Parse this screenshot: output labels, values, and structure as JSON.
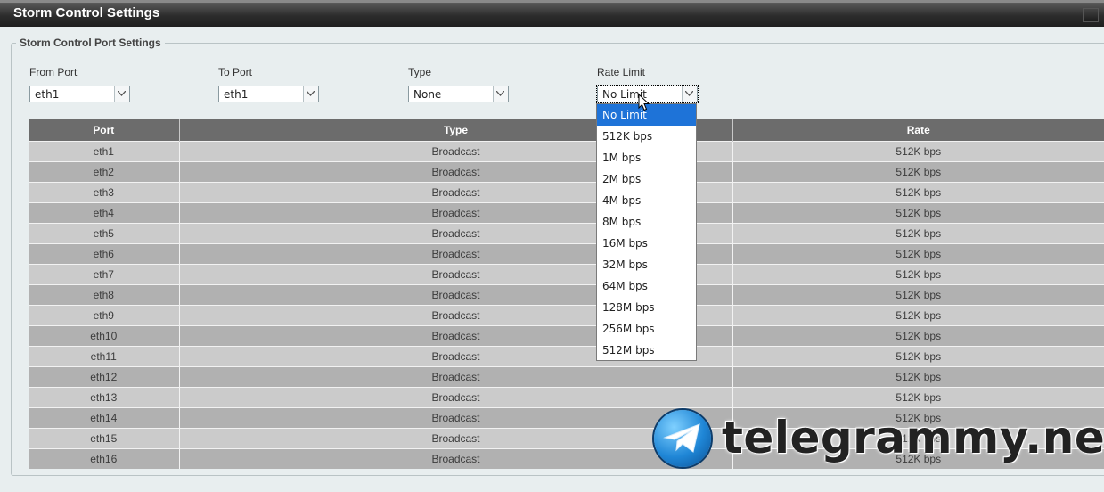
{
  "header": {
    "title": "Storm Control Settings"
  },
  "port_settings": {
    "legend": "Storm Control Port Settings",
    "from_port": {
      "label": "From Port",
      "value": "eth1"
    },
    "to_port": {
      "label": "To Port",
      "value": "eth1"
    },
    "type": {
      "label": "Type",
      "value": "None"
    },
    "rate_limit": {
      "label": "Rate Limit",
      "value": "No Limit",
      "options": [
        "No Limit",
        "512K bps",
        "1M bps",
        "2M bps",
        "4M bps",
        "8M bps",
        "16M bps",
        "32M bps",
        "64M bps",
        "128M bps",
        "256M bps",
        "512M bps"
      ],
      "selected_index": 0
    }
  },
  "table": {
    "columns": [
      "Port",
      "Type",
      "Rate"
    ],
    "rows": [
      {
        "port": "eth1",
        "type": "Broadcast",
        "rate": "512K bps"
      },
      {
        "port": "eth2",
        "type": "Broadcast",
        "rate": "512K bps"
      },
      {
        "port": "eth3",
        "type": "Broadcast",
        "rate": "512K bps"
      },
      {
        "port": "eth4",
        "type": "Broadcast",
        "rate": "512K bps"
      },
      {
        "port": "eth5",
        "type": "Broadcast",
        "rate": "512K bps"
      },
      {
        "port": "eth6",
        "type": "Broadcast",
        "rate": "512K bps"
      },
      {
        "port": "eth7",
        "type": "Broadcast",
        "rate": "512K bps"
      },
      {
        "port": "eth8",
        "type": "Broadcast",
        "rate": "512K bps"
      },
      {
        "port": "eth9",
        "type": "Broadcast",
        "rate": "512K bps"
      },
      {
        "port": "eth10",
        "type": "Broadcast",
        "rate": "512K bps"
      },
      {
        "port": "eth11",
        "type": "Broadcast",
        "rate": "512K bps"
      },
      {
        "port": "eth12",
        "type": "Broadcast",
        "rate": "512K bps"
      },
      {
        "port": "eth13",
        "type": "Broadcast",
        "rate": "512K bps"
      },
      {
        "port": "eth14",
        "type": "Broadcast",
        "rate": "512K bps"
      },
      {
        "port": "eth15",
        "type": "Broadcast",
        "rate": "512K bps"
      },
      {
        "port": "eth16",
        "type": "Broadcast",
        "rate": "512K bps"
      }
    ]
  },
  "watermark": {
    "text": "telegrammy.net",
    "icon": "telegram-logo-icon"
  },
  "colors": {
    "header_bg": "#2c2c2c",
    "table_header_bg": "#6c6c6c",
    "row_light": "#cbcbcb",
    "row_dark": "#b1b1b1",
    "selected_option": "#1e73d8"
  }
}
